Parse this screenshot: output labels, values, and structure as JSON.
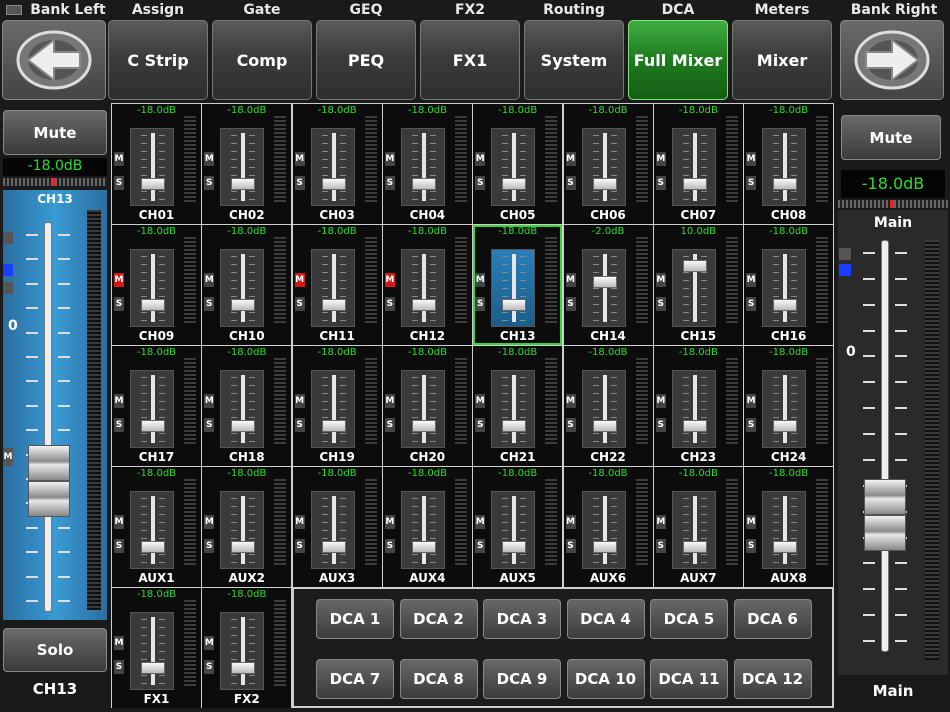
{
  "header": {
    "bank_left_label": "Bank Left",
    "bank_right_label": "Bank Right",
    "tabs": [
      {
        "group": "Assign",
        "label": "C Strip",
        "active": false
      },
      {
        "group": "Gate",
        "label": "Comp",
        "active": false
      },
      {
        "group": "GEQ",
        "label": "PEQ",
        "active": false
      },
      {
        "group": "FX2",
        "label": "FX1",
        "active": false
      },
      {
        "group": "Routing",
        "label": "System",
        "active": false
      },
      {
        "group": "DCA",
        "label": "Full Mixer",
        "active": true
      },
      {
        "group": "Meters",
        "label": "Mixer",
        "active": false
      }
    ]
  },
  "left_strip": {
    "mute_label": "Mute",
    "db": "-18.0dB",
    "channel_label": "CH13",
    "zero_label": "0",
    "m_label": "M",
    "solo_label": "Solo",
    "name": "CH13",
    "fader_level": 0.72
  },
  "right_strip": {
    "mute_label": "Mute",
    "db": "-18.0dB",
    "channel_label": "Main",
    "zero_label": "0",
    "name": "Main",
    "fader_level": 0.72
  },
  "channels": [
    {
      "name": "CH01",
      "db": "-18.0dB",
      "mute": false,
      "level": 0.72
    },
    {
      "name": "CH02",
      "db": "-18.0dB",
      "mute": false,
      "level": 0.72
    },
    {
      "name": "CH03",
      "db": "-18.0dB",
      "mute": false,
      "level": 0.72
    },
    {
      "name": "CH04",
      "db": "-18.0dB",
      "mute": false,
      "level": 0.72
    },
    {
      "name": "CH05",
      "db": "-18.0dB",
      "mute": false,
      "level": 0.72
    },
    {
      "name": "CH06",
      "db": "-18.0dB",
      "mute": false,
      "level": 0.72
    },
    {
      "name": "CH07",
      "db": "-18.0dB",
      "mute": false,
      "level": 0.72
    },
    {
      "name": "CH08",
      "db": "-18.0dB",
      "mute": false,
      "level": 0.72
    },
    {
      "name": "CH09",
      "db": "-18.0dB",
      "mute": true,
      "level": 0.72
    },
    {
      "name": "CH10",
      "db": "-18.0dB",
      "mute": false,
      "level": 0.72
    },
    {
      "name": "CH11",
      "db": "-18.0dB",
      "mute": true,
      "level": 0.72
    },
    {
      "name": "CH12",
      "db": "-18.0dB",
      "mute": true,
      "level": 0.72
    },
    {
      "name": "CH13",
      "db": "-18.0dB",
      "mute": false,
      "level": 0.72,
      "selected": true
    },
    {
      "name": "CH14",
      "db": "-2.0dB",
      "mute": false,
      "level": 0.35
    },
    {
      "name": "CH15",
      "db": "10.0dB",
      "mute": false,
      "level": 0.1
    },
    {
      "name": "CH16",
      "db": "-18.0dB",
      "mute": false,
      "level": 0.72
    },
    {
      "name": "CH17",
      "db": "-18.0dB",
      "mute": false,
      "level": 0.72
    },
    {
      "name": "CH18",
      "db": "-18.0dB",
      "mute": false,
      "level": 0.72
    },
    {
      "name": "CH19",
      "db": "-18.0dB",
      "mute": false,
      "level": 0.72
    },
    {
      "name": "CH20",
      "db": "-18.0dB",
      "mute": false,
      "level": 0.72
    },
    {
      "name": "CH21",
      "db": "-18.0dB",
      "mute": false,
      "level": 0.72
    },
    {
      "name": "CH22",
      "db": "-18.0dB",
      "mute": false,
      "level": 0.72
    },
    {
      "name": "CH23",
      "db": "-18.0dB",
      "mute": false,
      "level": 0.72
    },
    {
      "name": "CH24",
      "db": "-18.0dB",
      "mute": false,
      "level": 0.72
    },
    {
      "name": "AUX1",
      "db": "-18.0dB",
      "mute": false,
      "level": 0.72
    },
    {
      "name": "AUX2",
      "db": "-18.0dB",
      "mute": false,
      "level": 0.72
    },
    {
      "name": "AUX3",
      "db": "-18.0dB",
      "mute": false,
      "level": 0.72
    },
    {
      "name": "AUX4",
      "db": "-18.0dB",
      "mute": false,
      "level": 0.72
    },
    {
      "name": "AUX5",
      "db": "-18.0dB",
      "mute": false,
      "level": 0.72
    },
    {
      "name": "AUX6",
      "db": "-18.0dB",
      "mute": false,
      "level": 0.72
    },
    {
      "name": "AUX7",
      "db": "-18.0dB",
      "mute": false,
      "level": 0.72
    },
    {
      "name": "AUX8",
      "db": "-18.0dB",
      "mute": false,
      "level": 0.72
    },
    {
      "name": "FX1",
      "db": "-18.0dB",
      "mute": false,
      "level": 0.72
    },
    {
      "name": "FX2",
      "db": "-18.0dB",
      "mute": false,
      "level": 0.72
    }
  ],
  "strip_buttons": {
    "mute": "M",
    "solo": "S"
  },
  "dca_buttons": [
    "DCA 1",
    "DCA 2",
    "DCA 3",
    "DCA 4",
    "DCA 5",
    "DCA 6",
    "DCA 7",
    "DCA 8",
    "DCA 9",
    "DCA 10",
    "DCA 11",
    "DCA 12"
  ]
}
